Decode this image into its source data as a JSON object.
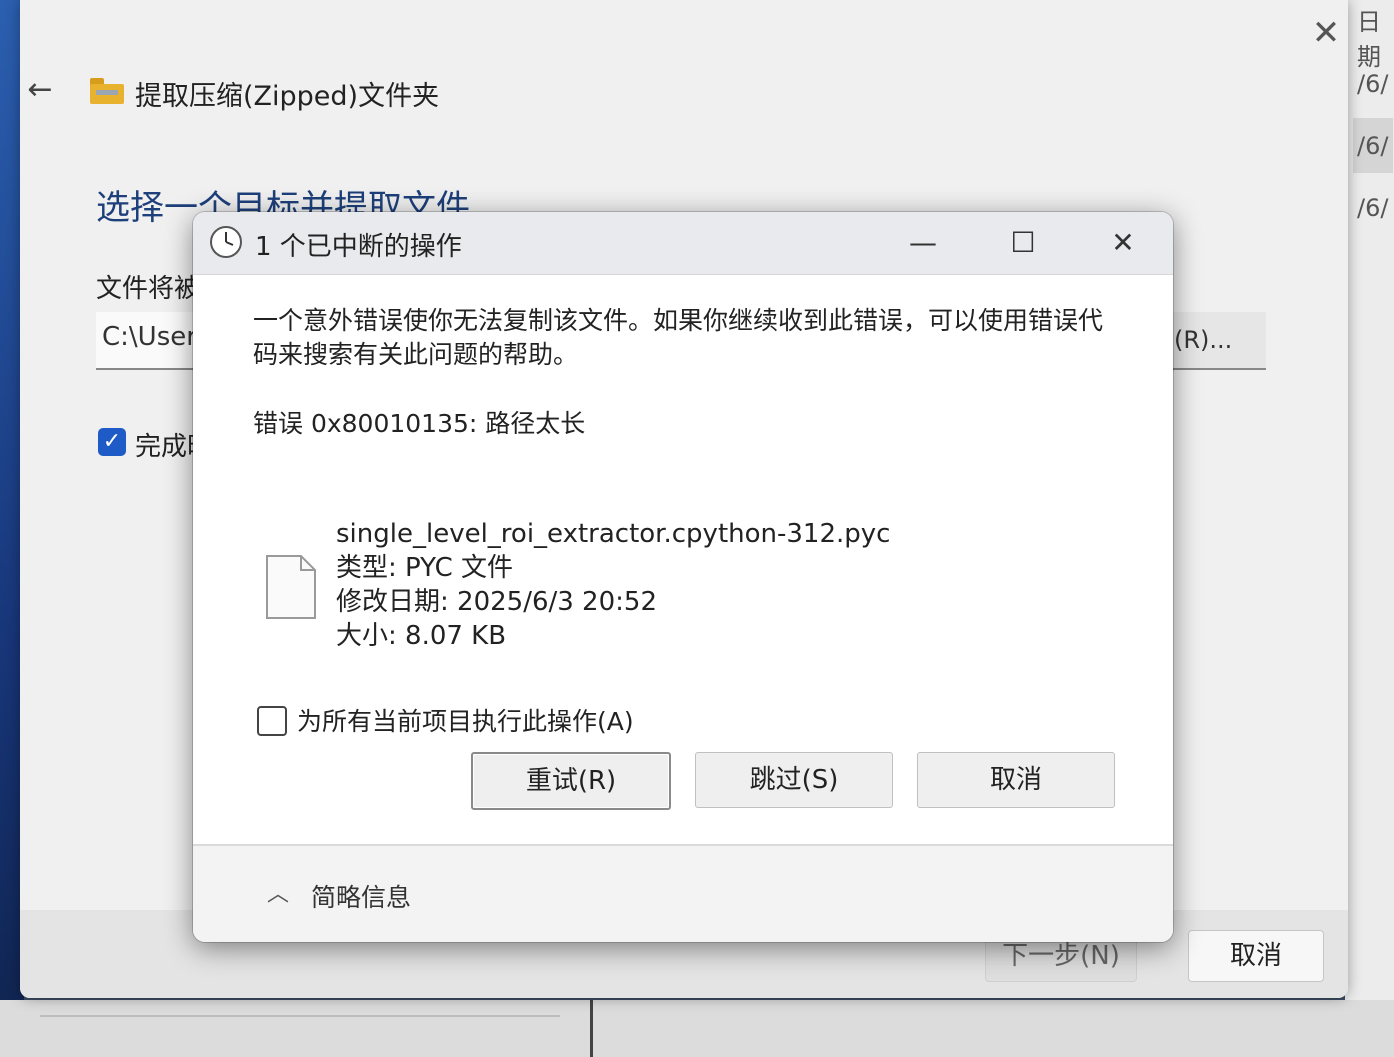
{
  "wizard": {
    "title": "提取压缩(Zipped)文件夹",
    "heading": "选择一个目标并提取文件",
    "dest_label": "文件将被",
    "path_value": "C:\\User",
    "browse_label": "(R)...",
    "show_files_label": "完成时",
    "next_label": "下一步(N)",
    "cancel_label": "取消"
  },
  "background_right": {
    "header": "日期",
    "rows": [
      "/6/",
      "/6/",
      "/6/"
    ]
  },
  "dialog": {
    "title": "1 个已中断的操作",
    "message": "一个意外错误使你无法复制该文件。如果你继续收到此错误，可以使用错误代码来搜索有关此问题的帮助。",
    "error": "错误 0x80010135: 路径太长",
    "file": {
      "name": "single_level_roi_extractor.cpython-312.pyc",
      "type": "类型: PYC 文件",
      "modified": "修改日期: 2025/6/3 20:52",
      "size": "大小: 8.07 KB"
    },
    "apply_all_label": "为所有当前项目执行此操作(A)",
    "apply_all_checked": false,
    "buttons": {
      "retry": "重试(R)",
      "skip": "跳过(S)",
      "cancel": "取消"
    },
    "details_label": "简略信息"
  }
}
